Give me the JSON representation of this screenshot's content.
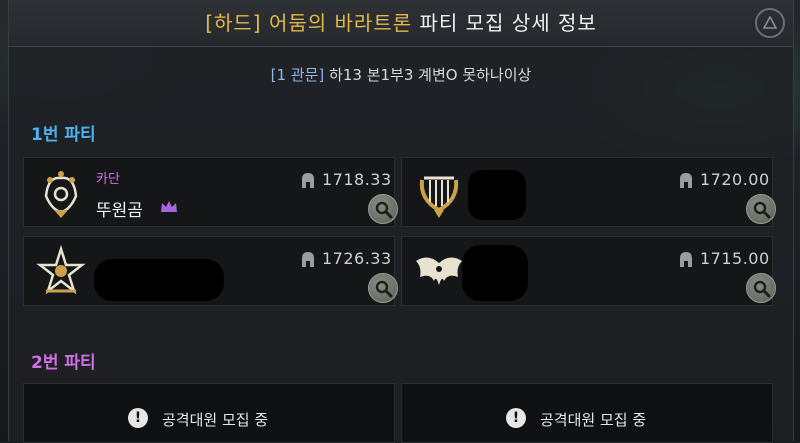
{
  "title": {
    "mode": "[하드]",
    "raid": "어둠의 바라트론",
    "rest": "파티 모집 상세 정보"
  },
  "subtitle": {
    "tag": "[1 관문]",
    "text": "하13 본1부3 계변O 못하나이상"
  },
  "party1": {
    "label": "1번 파티",
    "members": [
      {
        "class_icon": "warrior-emblem-icon",
        "class_name": "카단",
        "nickname": "뚜원곰",
        "leader_icon": "crown-icon",
        "item_level": "1718.33"
      },
      {
        "class_icon": "lyre-emblem-icon",
        "class_name": "",
        "nickname": "",
        "item_level": "1720.00"
      },
      {
        "class_icon": "star-emblem-icon",
        "class_name": "",
        "nickname": "",
        "item_level": "1726.33"
      },
      {
        "class_icon": "demon-wings-emblem-icon",
        "class_name": "",
        "nickname": "",
        "item_level": "1715.00"
      }
    ]
  },
  "party2": {
    "label": "2번 파티",
    "slots": [
      {
        "icon": "exclamation-icon",
        "text": "공격대원 모집 중"
      },
      {
        "icon": "exclamation-icon",
        "text": "공격대원 모집 중"
      }
    ]
  },
  "colors": {
    "gold": "#e3b84a",
    "party1": "#4fb1ef",
    "party2": "#d070e8"
  }
}
